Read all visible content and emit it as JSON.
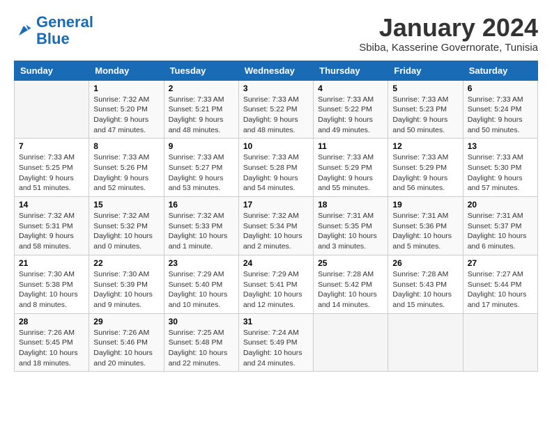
{
  "logo": {
    "text_general": "General",
    "text_blue": "Blue"
  },
  "title": "January 2024",
  "location": "Sbiba, Kasserine Governorate, Tunisia",
  "days_of_week": [
    "Sunday",
    "Monday",
    "Tuesday",
    "Wednesday",
    "Thursday",
    "Friday",
    "Saturday"
  ],
  "weeks": [
    [
      {
        "day": "",
        "info": ""
      },
      {
        "day": "1",
        "info": "Sunrise: 7:32 AM\nSunset: 5:20 PM\nDaylight: 9 hours\nand 47 minutes."
      },
      {
        "day": "2",
        "info": "Sunrise: 7:33 AM\nSunset: 5:21 PM\nDaylight: 9 hours\nand 48 minutes."
      },
      {
        "day": "3",
        "info": "Sunrise: 7:33 AM\nSunset: 5:22 PM\nDaylight: 9 hours\nand 48 minutes."
      },
      {
        "day": "4",
        "info": "Sunrise: 7:33 AM\nSunset: 5:22 PM\nDaylight: 9 hours\nand 49 minutes."
      },
      {
        "day": "5",
        "info": "Sunrise: 7:33 AM\nSunset: 5:23 PM\nDaylight: 9 hours\nand 50 minutes."
      },
      {
        "day": "6",
        "info": "Sunrise: 7:33 AM\nSunset: 5:24 PM\nDaylight: 9 hours\nand 50 minutes."
      }
    ],
    [
      {
        "day": "7",
        "info": "Sunrise: 7:33 AM\nSunset: 5:25 PM\nDaylight: 9 hours\nand 51 minutes."
      },
      {
        "day": "8",
        "info": "Sunrise: 7:33 AM\nSunset: 5:26 PM\nDaylight: 9 hours\nand 52 minutes."
      },
      {
        "day": "9",
        "info": "Sunrise: 7:33 AM\nSunset: 5:27 PM\nDaylight: 9 hours\nand 53 minutes."
      },
      {
        "day": "10",
        "info": "Sunrise: 7:33 AM\nSunset: 5:28 PM\nDaylight: 9 hours\nand 54 minutes."
      },
      {
        "day": "11",
        "info": "Sunrise: 7:33 AM\nSunset: 5:29 PM\nDaylight: 9 hours\nand 55 minutes."
      },
      {
        "day": "12",
        "info": "Sunrise: 7:33 AM\nSunset: 5:29 PM\nDaylight: 9 hours\nand 56 minutes."
      },
      {
        "day": "13",
        "info": "Sunrise: 7:33 AM\nSunset: 5:30 PM\nDaylight: 9 hours\nand 57 minutes."
      }
    ],
    [
      {
        "day": "14",
        "info": "Sunrise: 7:32 AM\nSunset: 5:31 PM\nDaylight: 9 hours\nand 58 minutes."
      },
      {
        "day": "15",
        "info": "Sunrise: 7:32 AM\nSunset: 5:32 PM\nDaylight: 10 hours\nand 0 minutes."
      },
      {
        "day": "16",
        "info": "Sunrise: 7:32 AM\nSunset: 5:33 PM\nDaylight: 10 hours\nand 1 minute."
      },
      {
        "day": "17",
        "info": "Sunrise: 7:32 AM\nSunset: 5:34 PM\nDaylight: 10 hours\nand 2 minutes."
      },
      {
        "day": "18",
        "info": "Sunrise: 7:31 AM\nSunset: 5:35 PM\nDaylight: 10 hours\nand 3 minutes."
      },
      {
        "day": "19",
        "info": "Sunrise: 7:31 AM\nSunset: 5:36 PM\nDaylight: 10 hours\nand 5 minutes."
      },
      {
        "day": "20",
        "info": "Sunrise: 7:31 AM\nSunset: 5:37 PM\nDaylight: 10 hours\nand 6 minutes."
      }
    ],
    [
      {
        "day": "21",
        "info": "Sunrise: 7:30 AM\nSunset: 5:38 PM\nDaylight: 10 hours\nand 8 minutes."
      },
      {
        "day": "22",
        "info": "Sunrise: 7:30 AM\nSunset: 5:39 PM\nDaylight: 10 hours\nand 9 minutes."
      },
      {
        "day": "23",
        "info": "Sunrise: 7:29 AM\nSunset: 5:40 PM\nDaylight: 10 hours\nand 10 minutes."
      },
      {
        "day": "24",
        "info": "Sunrise: 7:29 AM\nSunset: 5:41 PM\nDaylight: 10 hours\nand 12 minutes."
      },
      {
        "day": "25",
        "info": "Sunrise: 7:28 AM\nSunset: 5:42 PM\nDaylight: 10 hours\nand 14 minutes."
      },
      {
        "day": "26",
        "info": "Sunrise: 7:28 AM\nSunset: 5:43 PM\nDaylight: 10 hours\nand 15 minutes."
      },
      {
        "day": "27",
        "info": "Sunrise: 7:27 AM\nSunset: 5:44 PM\nDaylight: 10 hours\nand 17 minutes."
      }
    ],
    [
      {
        "day": "28",
        "info": "Sunrise: 7:26 AM\nSunset: 5:45 PM\nDaylight: 10 hours\nand 18 minutes."
      },
      {
        "day": "29",
        "info": "Sunrise: 7:26 AM\nSunset: 5:46 PM\nDaylight: 10 hours\nand 20 minutes."
      },
      {
        "day": "30",
        "info": "Sunrise: 7:25 AM\nSunset: 5:48 PM\nDaylight: 10 hours\nand 22 minutes."
      },
      {
        "day": "31",
        "info": "Sunrise: 7:24 AM\nSunset: 5:49 PM\nDaylight: 10 hours\nand 24 minutes."
      },
      {
        "day": "",
        "info": ""
      },
      {
        "day": "",
        "info": ""
      },
      {
        "day": "",
        "info": ""
      }
    ]
  ]
}
